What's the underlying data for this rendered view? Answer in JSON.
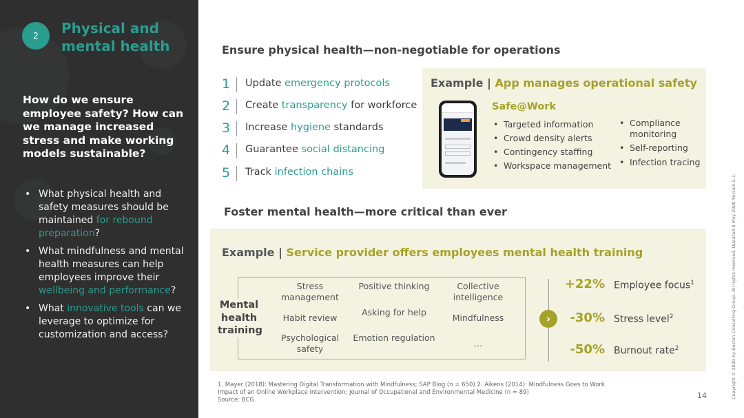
{
  "sidebar": {
    "badge": "2",
    "title_line1": "Physical and",
    "title_line2": "mental health",
    "question": "How do we ensure employee safety? How can we manage increased stress and make working models sustainable?",
    "bullets": [
      {
        "a": "What physical health and safety measures should be maintained ",
        "hl": "for rebound preparation",
        "b": "?"
      },
      {
        "a": "What mindfulness and mental health measures can help employees improve their ",
        "hl": "wellbeing and performance",
        "b": "?"
      },
      {
        "a": "What ",
        "hl": "innovative tools",
        "b": " can we leverage to optimize for customization and access?"
      }
    ]
  },
  "physical": {
    "heading": "Ensure physical health—non-negotiable for operations",
    "items": [
      {
        "n": "1",
        "a": "Update ",
        "hl": "emergency protocols",
        "b": ""
      },
      {
        "n": "2",
        "a": "Create ",
        "hl": "transparency",
        "b": " for workforce"
      },
      {
        "n": "3",
        "a": "Increase ",
        "hl": "hygiene",
        "b": " standards"
      },
      {
        "n": "4",
        "a": "Guarantee ",
        "hl": "social distancing",
        "b": ""
      },
      {
        "n": "5",
        "a": "Track ",
        "hl": "infection chains",
        "b": ""
      }
    ],
    "example": {
      "label": "Example | ",
      "title": "App manages operational safety",
      "app_name": "Safe@Work",
      "col1": [
        "Targeted information",
        "Crowd density alerts",
        "Contingency staffing",
        "Workspace management"
      ],
      "col2": [
        "Compliance monitoring",
        "Self-reporting",
        "Infection tracing"
      ]
    }
  },
  "mental": {
    "heading": "Foster mental health—more critical than ever",
    "example_label": "Example | ",
    "example_title": "Service provider offers employees mental health training",
    "training_label": "Mental health training",
    "cells": [
      "Stress management",
      "Positive thinking",
      "Collective intelligence",
      "Habit review",
      "Asking for help",
      "Mindfulness",
      "Psychological safety",
      "Emotion regulation",
      "…"
    ],
    "stats": [
      {
        "value": "+22%",
        "label": "Employee focus",
        "sup": "1"
      },
      {
        "value": "-30%",
        "label": "Stress level",
        "sup": "2"
      },
      {
        "value": "-50%",
        "label": "Burnout rate",
        "sup": "2"
      }
    ]
  },
  "footer": {
    "note1": "1. Mayer (2018): Mastering Digital Transformation with Mindfulness; SAP Blog (n = 650)   2. Aikens (2014): Mindfulness Goes to Work Impact of an Online Workplace Intervention; Journal of Occupational and Environmental Medicine (n = 89)",
    "source": "Source: BCG",
    "page": "14",
    "copyright": "Copyright © 2020 by Boston Consulting Group. All rights reserved.  Updated 8 May 2020 Version 5.1."
  },
  "colors": {
    "teal": "#2a9d8f",
    "olive": "#a5a22a",
    "panel": "#2f2f2f",
    "box": "#f4f2e1"
  }
}
